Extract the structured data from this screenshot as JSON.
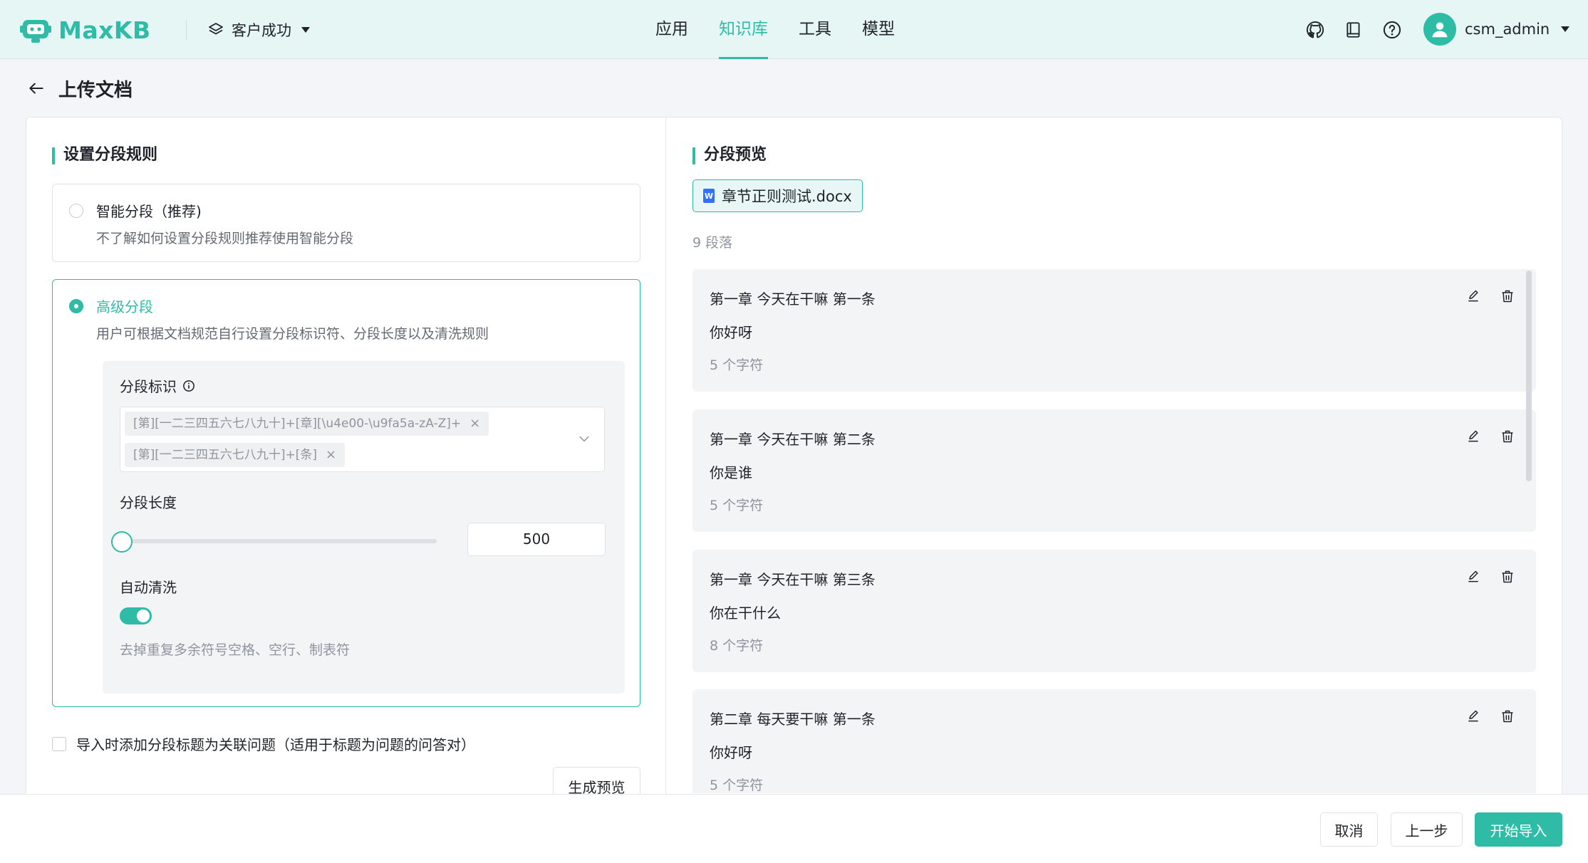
{
  "header": {
    "logo_text": "MaxKB",
    "workspace": "客户成功",
    "nav": [
      {
        "label": "应用",
        "active": false
      },
      {
        "label": "知识库",
        "active": true
      },
      {
        "label": "工具",
        "active": false
      },
      {
        "label": "模型",
        "active": false
      }
    ],
    "icons": [
      "github-icon",
      "book-icon",
      "help-icon"
    ],
    "username": "csm_admin"
  },
  "page": {
    "title": "上传文档"
  },
  "rules": {
    "section_title": "设置分段规则",
    "smart": {
      "title": "智能分段（推荐)",
      "desc": "不了解如何设置分段规则推荐使用智能分段",
      "selected": false
    },
    "advanced": {
      "title": "高级分段",
      "desc": "用户可根据文档规范自行设置分段标识符、分段长度以及清洗规则",
      "selected": true,
      "separator_label": "分段标识",
      "separators": [
        "[第][一二三四五六七八九十]+[章][\\u4e00-\\u9fa5a-zA-Z]+",
        "[第][一二三四五六七八九十]+[条]"
      ],
      "length_label": "分段长度",
      "length_value": "500",
      "length_slider_fraction": 0.0,
      "clean_label": "自动清洗",
      "clean_on": true,
      "clean_help": "去掉重复多余符号空格、空行、制表符"
    },
    "checkbox_label": "导入时添加分段标题为关联问题（适用于标题为问题的问答对）",
    "preview_button": "生成预览"
  },
  "preview": {
    "section_title": "分段预览",
    "file_name": "章节正则测试.docx",
    "file_icon_letter": "W",
    "count_text": "9 段落",
    "paragraphs": [
      {
        "title": "第一章 今天在干嘛 第一条",
        "content": "你好呀",
        "chars": "5 个字符"
      },
      {
        "title": "第一章 今天在干嘛 第二条",
        "content": "你是谁",
        "chars": "5 个字符"
      },
      {
        "title": "第一章 今天在干嘛 第三条",
        "content": "你在干什么",
        "chars": "8 个字符"
      },
      {
        "title": "第二章 每天要干嘛 第一条",
        "content": "你好呀",
        "chars": "5 个字符"
      }
    ]
  },
  "footer": {
    "cancel": "取消",
    "prev": "上一步",
    "start": "开始导入"
  },
  "colors": {
    "accent": "#2ebca7",
    "header_bg": "#e6f6f4",
    "doc_blue": "#3370ff"
  }
}
